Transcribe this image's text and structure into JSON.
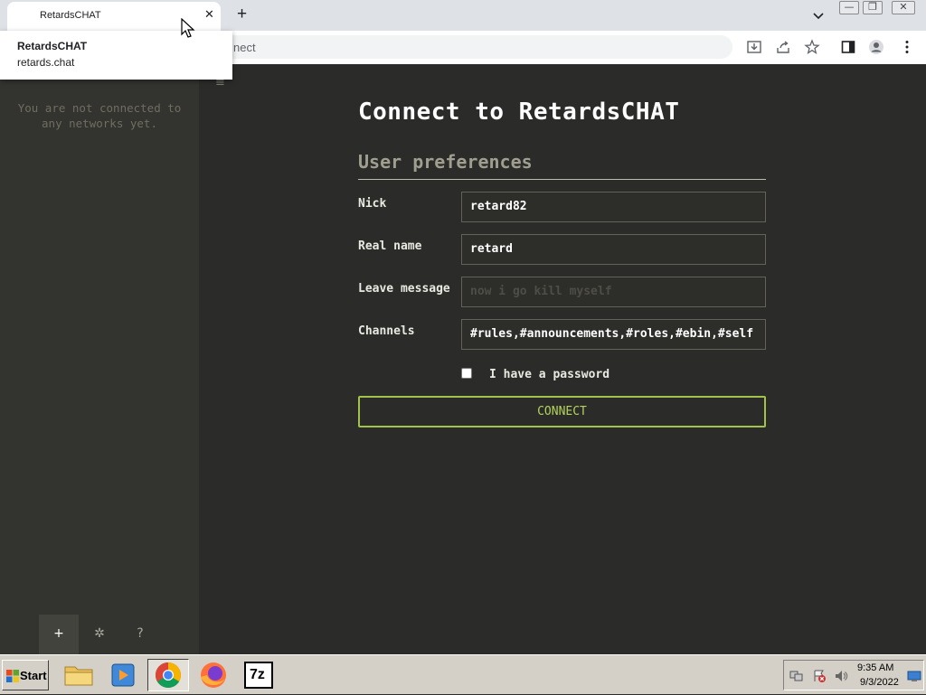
{
  "browser": {
    "tab_title": "RetardsCHAT",
    "new_tab_label": "+",
    "omnibox_visible_text": "nect",
    "window_controls": {
      "minimize": "—",
      "maximize": "❐",
      "close": "✕"
    }
  },
  "hover_card": {
    "title": "RetardsCHAT",
    "url": "retards.chat"
  },
  "sidebar": {
    "empty_message": "You are not connected to any networks yet.",
    "footer": {
      "add": "+",
      "settings": "✲",
      "help": "?"
    },
    "menu_toggle": "≡"
  },
  "form": {
    "heading": "Connect to RetardsCHAT",
    "section_title": "User preferences",
    "fields": [
      {
        "label": "Nick",
        "value": "retard82",
        "placeholder": ""
      },
      {
        "label": "Real name",
        "value": "retard",
        "placeholder": ""
      },
      {
        "label": "Leave message",
        "value": "",
        "placeholder": "now i go kill myself"
      },
      {
        "label": "Channels",
        "value": "#rules,#announcements,#roles,#ebin,#self",
        "placeholder": ""
      }
    ],
    "password_checkbox": {
      "label": "I have a password",
      "checked": false
    },
    "connect_button": "CONNECT"
  },
  "taskbar": {
    "start_label": "Start",
    "apps": [
      "explorer",
      "media-player",
      "chrome",
      "firefox",
      "7-zip"
    ],
    "sevenzip_label": "7z",
    "clock_time": "9:35 AM",
    "clock_date": "9/3/2022"
  },
  "colors": {
    "page_bg": "#2b2b29",
    "sidebar_bg": "#33332f",
    "accent_green": "#a2c24a",
    "muted_text": "#6f6e60"
  }
}
